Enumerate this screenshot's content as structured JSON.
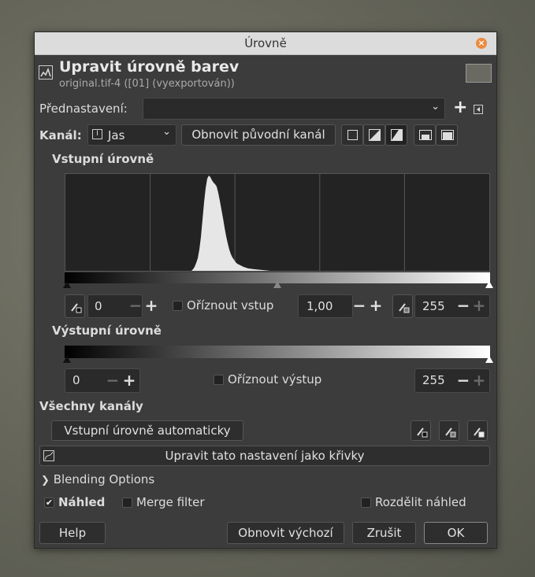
{
  "window": {
    "title": "Úrovně"
  },
  "header": {
    "title": "Upravit úrovně barev",
    "subtitle": "original.tif-4 ([01] (vyexportován))"
  },
  "presets": {
    "label": "Přednastavení:",
    "value": ""
  },
  "channel": {
    "label": "Kanál:",
    "value": "Jas",
    "reset_label": "Obnovit původní kanál"
  },
  "input_levels": {
    "heading": "Vstupní úrovně",
    "low": "0",
    "gamma": "1,00",
    "high": "255",
    "clip_label": "Oříznout vstup",
    "gamma_position": 0.5
  },
  "histogram": {
    "bins_peak_at": 0.4,
    "grid_lines": 5
  },
  "output_levels": {
    "heading": "Výstupní úrovně",
    "low": "0",
    "high": "255",
    "clip_label": "Oříznout výstup"
  },
  "all_channels": {
    "heading": "Všechny kanály",
    "auto_label": "Vstupní úrovně automaticky"
  },
  "curves_button": "Upravit tato nastavení jako křivky",
  "blending": "Blending Options",
  "preview": {
    "label": "Náhled",
    "checked": true
  },
  "merge": {
    "label": "Merge filter",
    "checked": false
  },
  "split": {
    "label": "Rozdělit náhled",
    "checked": false
  },
  "buttons": {
    "help": "Help",
    "reset": "Obnovit výchozí",
    "cancel": "Zrušit",
    "ok": "OK"
  },
  "colors": {
    "dialog_bg": "#3c3c3c",
    "histogram": "#e6e6e6",
    "close": "#ec8a3e"
  }
}
